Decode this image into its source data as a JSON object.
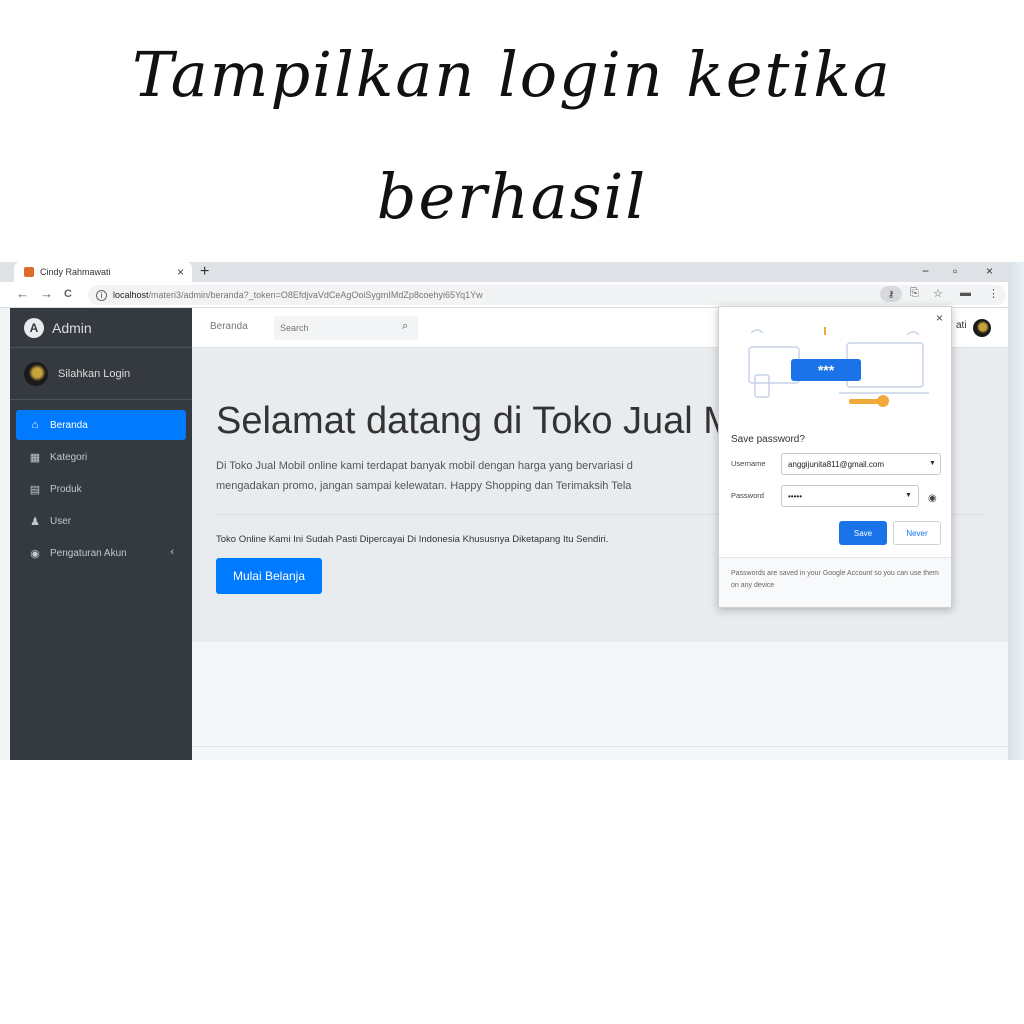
{
  "caption": {
    "line1": "Tampilkan login ketika",
    "line2": "berhasil"
  },
  "browser": {
    "tab_title": "Cindy Rahmawati",
    "tab_close": "×",
    "new_tab": "+",
    "minimize": "−",
    "restore": "▫",
    "close": "×",
    "back": "←",
    "forward": "→",
    "reload": "C",
    "info": "i",
    "url_host": "localhost",
    "url_path": "/materi3/admin/beranda?_token=O8EfdjvaVdCeAgOoiSygmIMdZp8coehyi65Yq1Yw",
    "key_icon": "⚷",
    "translate_icon": "⎘",
    "star_icon": "☆",
    "ext_icon": "▬",
    "menu_icon": "⋮"
  },
  "sidebar": {
    "brand_letter": "A",
    "brand": "Admin",
    "user": "Silahkan Login",
    "items": [
      {
        "label": "Beranda",
        "icon": "⌂"
      },
      {
        "label": "Kategori",
        "icon": "▦"
      },
      {
        "label": "Produk",
        "icon": "▤"
      },
      {
        "label": "User",
        "icon": "♟"
      },
      {
        "label": "Pengaturan Akun",
        "icon": "◉",
        "chevron": "‹"
      }
    ]
  },
  "navbar": {
    "link": "Beranda",
    "search_placeholder": "Search",
    "search_icon": "⌕",
    "user_suffix": "ati"
  },
  "jumbotron": {
    "title": "Selamat datang di Toko Jual M",
    "lead1": "Di Toko Jual Mobil online kami terdapat banyak mobil dengan harga yang bervariasi d",
    "lead2": "mengadakan promo, jangan sampai kelewatan. Happy Shopping dan Terimaksih Tela",
    "text": "Toko Online Kami Ini Sudah Pasti Dipercayai Di Indonesia Khususnya Diketapang Itu Sendiri.",
    "button": "Mulai Belanja"
  },
  "password_popup": {
    "close": "×",
    "masked_illustration": "***",
    "title": "Save password?",
    "username_label": "Username",
    "username_value": "anggijunita811@gmail.com",
    "password_label": "Password",
    "password_value": "•••••",
    "caret": "▼",
    "eye_icon": "◉",
    "save": "Save",
    "never": "Never",
    "footer": "Passwords are saved in your Google Account so you can use them on any device"
  }
}
